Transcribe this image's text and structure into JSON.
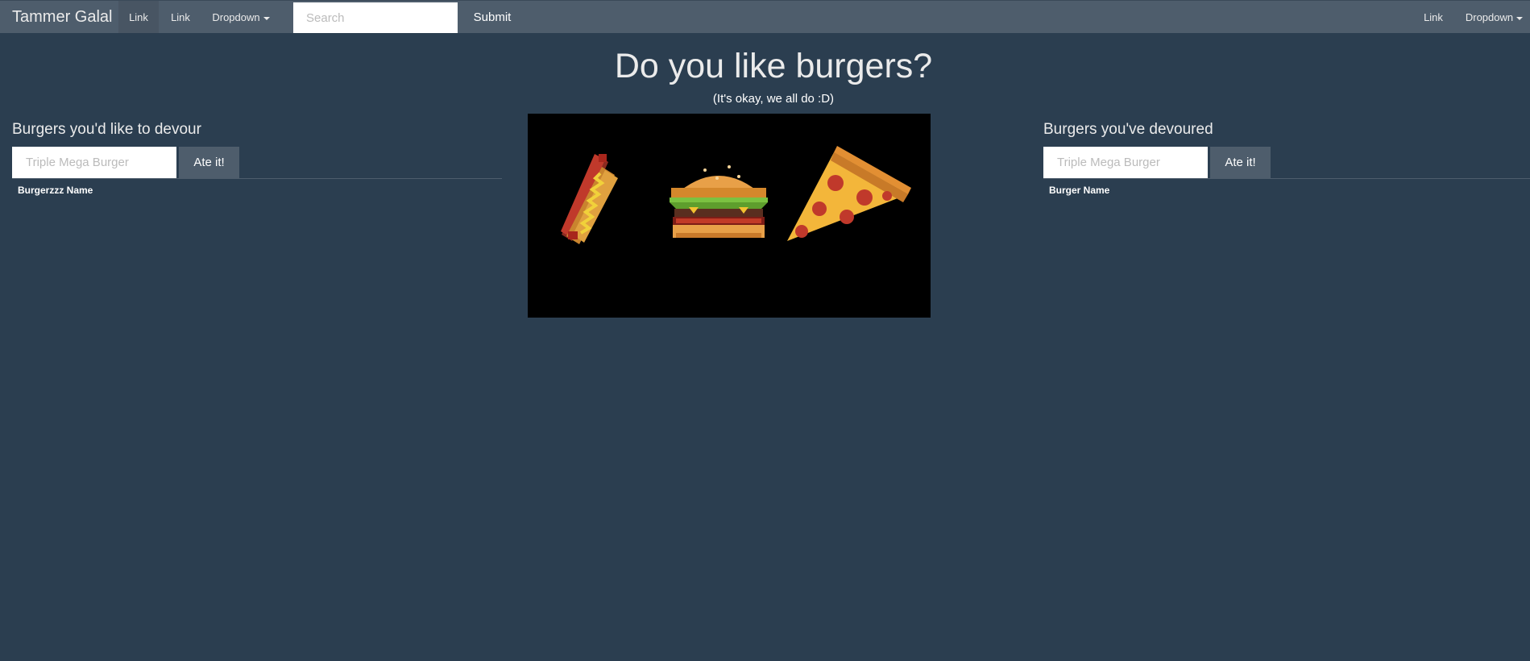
{
  "navbar": {
    "brand": "Tammer Galal",
    "links": [
      "Link",
      "Link"
    ],
    "dropdown_label": "Dropdown",
    "search_placeholder": "Search",
    "submit_label": "Submit",
    "right_link": "Link",
    "right_dropdown_label": "Dropdown"
  },
  "header": {
    "title": "Do you like burgers?",
    "subtitle": "(It's okay, we all do :D)"
  },
  "hero": {
    "icons": [
      "hotdog-icon",
      "burger-icon",
      "pizza-icon"
    ]
  },
  "left_panel": {
    "heading": "Burgers you'd like to devour",
    "input_placeholder": "Triple Mega Burger",
    "button_label": "Ate it!",
    "column_header": "Burgerzzz Name"
  },
  "right_panel": {
    "heading": "Burgers you've devoured",
    "input_placeholder": "Triple Mega Burger",
    "button_label": "Ate it!",
    "column_header": "Burger Name"
  },
  "colors": {
    "background": "#2b3e50",
    "navbar": "#4e5d6c",
    "text": "#ebebeb"
  }
}
